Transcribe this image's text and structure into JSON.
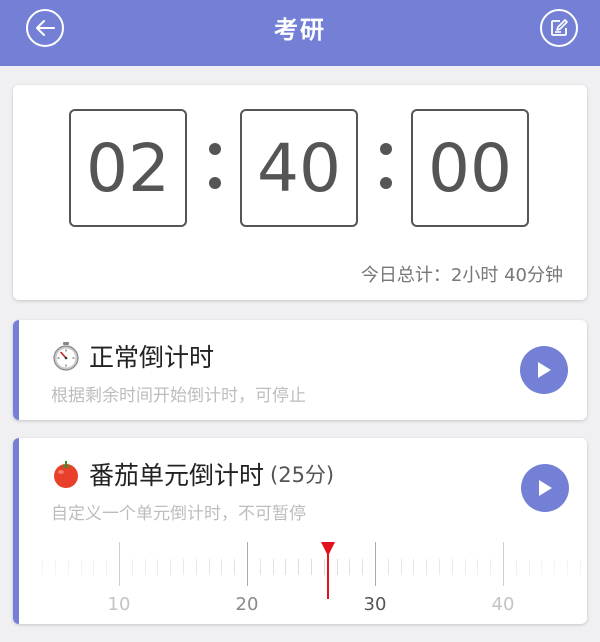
{
  "header": {
    "title": "考研"
  },
  "timer": {
    "hours": "02",
    "minutes": "40",
    "seconds": "00",
    "today_total": "今日总计：2小时 40分钟"
  },
  "modes": {
    "normal": {
      "title": "正常倒计时",
      "desc": "根据剩余时间开始倒计时，可停止",
      "icon": "stopwatch-icon"
    },
    "tomato": {
      "title": "番茄单元倒计时",
      "suffix": "(25分)",
      "desc": "自定义一个单元倒计时，不可暂停",
      "icon": "tomato-icon",
      "selected_minutes": 25,
      "ruler_labels": [
        "10",
        "20",
        "30",
        "40"
      ]
    }
  },
  "colors": {
    "accent": "#7480d6",
    "needle": "#e5101e"
  }
}
